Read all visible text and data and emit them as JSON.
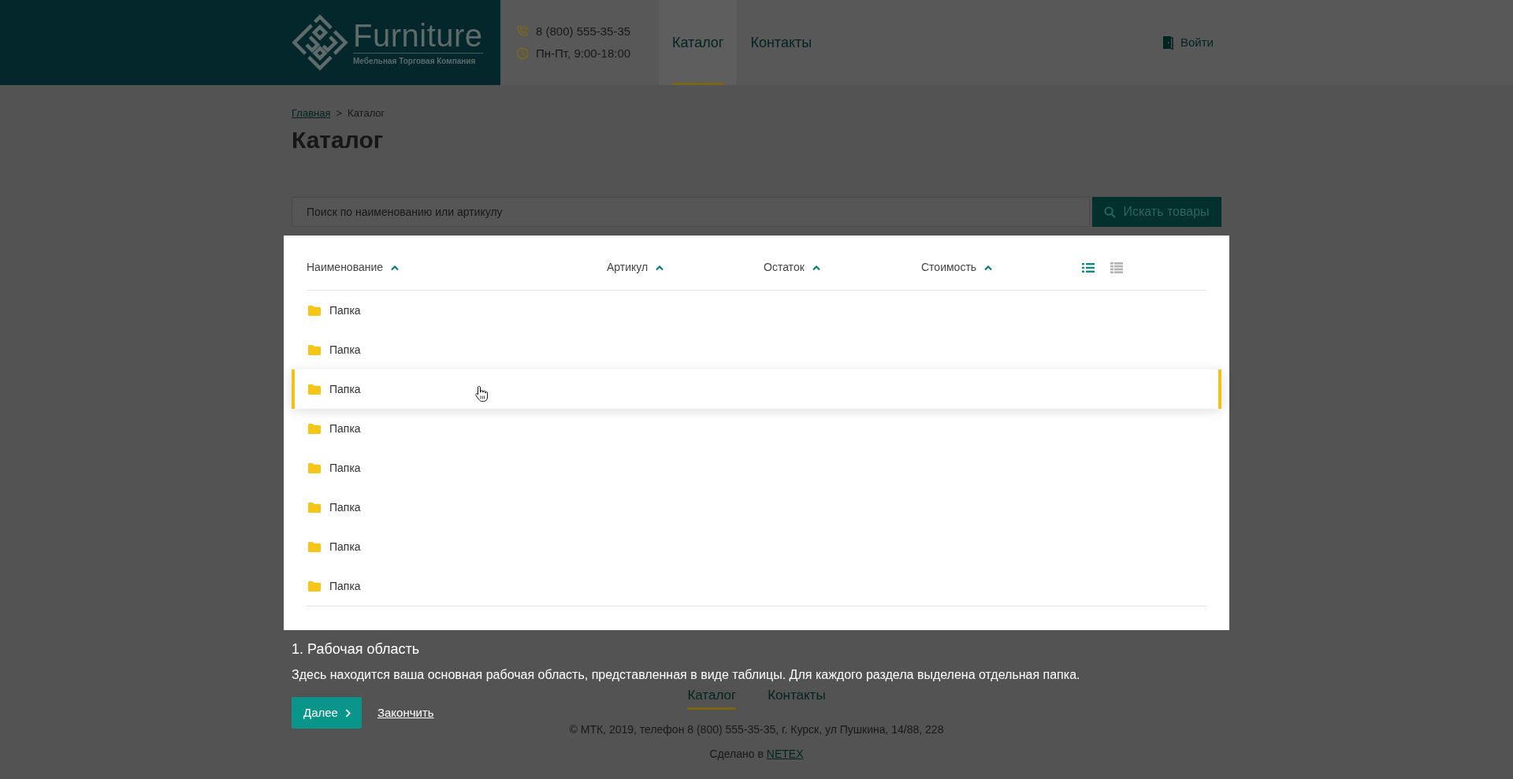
{
  "header": {
    "logo": {
      "name": "Furniture",
      "tagline": "Мебельная Торговая Компания"
    },
    "contacts": [
      {
        "kind": "phone",
        "text": "8 (800) 555-35-35"
      },
      {
        "kind": "hours",
        "text": "Пн-Пт, 9:00-18:00"
      }
    ],
    "nav": [
      {
        "label": "Каталог",
        "selected": true
      },
      {
        "label": "Контакты",
        "selected": false
      }
    ],
    "login": "Войти"
  },
  "breadcrumb": {
    "items": [
      {
        "label": "Главная",
        "kind": "link"
      },
      {
        "label": "Каталог",
        "kind": "current"
      }
    ],
    "separator": ">"
  },
  "page_title": "Каталог",
  "search": {
    "placeholder": "Поиск по наименованию или артикулу",
    "button": "Искать товары"
  },
  "table": {
    "columns": [
      {
        "label": "Наименование",
        "ascending": true
      },
      {
        "label": "Артикул",
        "ascending": true
      },
      {
        "label": "Остаток",
        "ascending": true
      },
      {
        "label": "Стоимость",
        "ascending": true
      }
    ],
    "view_modes": [
      {
        "kind": "list",
        "selected": true
      },
      {
        "kind": "grid",
        "selected": false
      }
    ],
    "rows": [
      {
        "kind": "folder",
        "name": "Папка",
        "hovered": false
      },
      {
        "kind": "folder",
        "name": "Папка",
        "hovered": false
      },
      {
        "kind": "folder",
        "name": "Папка",
        "hovered": true
      },
      {
        "kind": "folder",
        "name": "Папка",
        "hovered": false
      },
      {
        "kind": "folder",
        "name": "Папка",
        "hovered": false
      },
      {
        "kind": "folder",
        "name": "Папка",
        "hovered": false
      },
      {
        "kind": "folder",
        "name": "Папка",
        "hovered": false
      },
      {
        "kind": "folder",
        "name": "Папка",
        "hovered": false
      }
    ]
  },
  "tour": {
    "title": "1. Рабочая область",
    "text": "Здесь находится ваша основная рабочая область, представленная в виде таблицы. Для каждого раздела выделена отдельная папка.",
    "next_button": "Далее",
    "finish_link": "Закончить"
  },
  "footer": {
    "nav": [
      {
        "label": "Каталог",
        "selected": true
      },
      {
        "label": "Контакты",
        "selected": false
      }
    ],
    "copyright": "© МТК, 2019, телефон 8 (800) 555-35-35, г. Курск, ул Пушкина, 14/88, 228",
    "made_by": {
      "text": "Сделано в",
      "link": "NETEX"
    }
  }
}
